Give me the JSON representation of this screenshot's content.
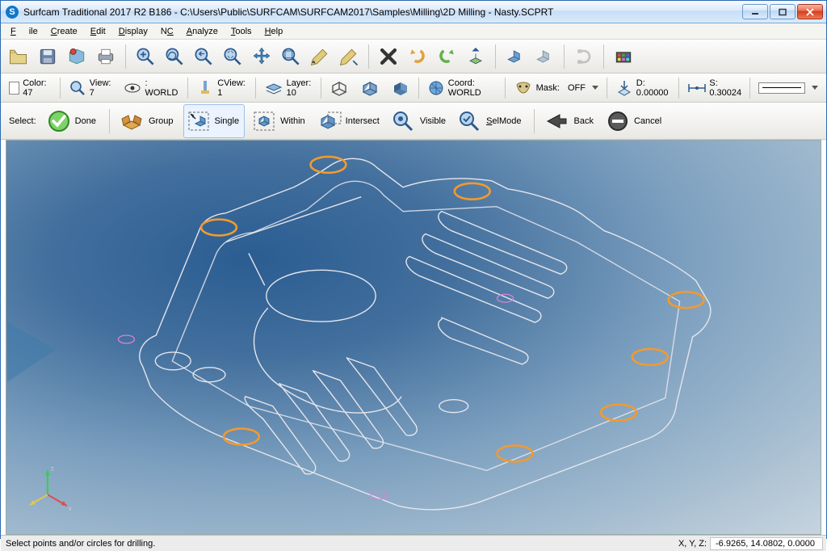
{
  "titlebar": {
    "app_letter": "S",
    "title": "Surfcam Traditional 2017 R2  B186 - C:\\Users\\Public\\SURFCAM\\SURFCAM2017\\Samples\\Milling\\2D Milling - Nasty.SCPRT"
  },
  "menu": {
    "file": "File",
    "create": "Create",
    "edit": "Edit",
    "display": "Display",
    "nc": "NC",
    "analyze": "Analyze",
    "tools": "Tools",
    "help": "Help"
  },
  "props": {
    "color_label": "Color: 47",
    "view_label": "View: 7",
    "world_label": ": WORLD",
    "cview_label": "CView: 1",
    "layer_label": "Layer: 10",
    "coord_label": "Coord: WORLD",
    "mask_label": "Mask:",
    "mask_value": "OFF",
    "d_label": "D: 0.00000",
    "s_label": "S: 0.30024"
  },
  "select": {
    "label": "Select:",
    "done": "Done",
    "group": "Group",
    "single": "Single",
    "within": "Within",
    "intersect": "Intersect",
    "visible": "Visible",
    "selmode": "SelMode",
    "back": "Back",
    "cancel": "Cancel"
  },
  "status": {
    "message": "Select points and/or circles for drilling.",
    "xyz_label": "X, Y, Z:",
    "xyz_value": "-6.9265, 14.0802, 0.0000"
  }
}
